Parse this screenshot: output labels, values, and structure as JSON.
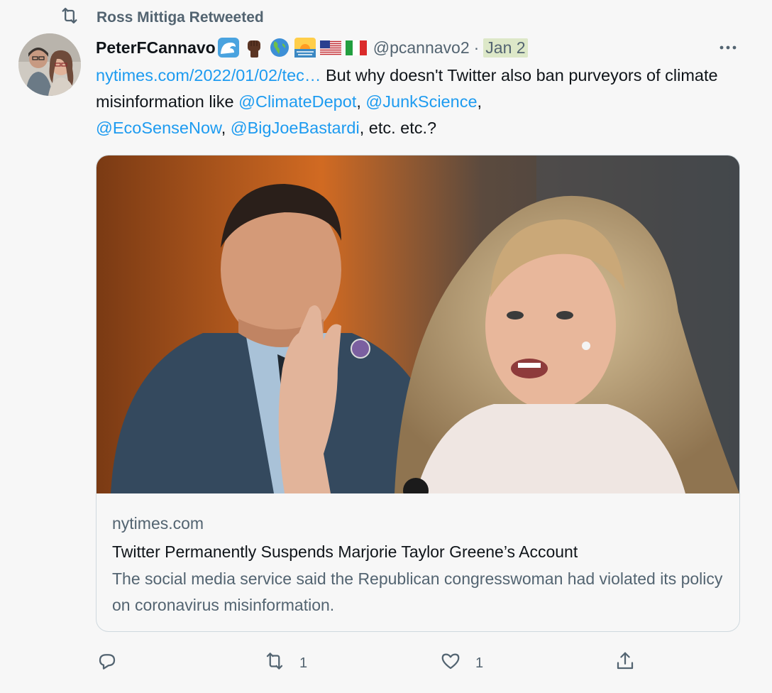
{
  "social_context": {
    "text": "Ross Mittiga Retweeted"
  },
  "author": {
    "display_name": "PeterFCannavo",
    "emojis": [
      "wave-emoji",
      "raised-fist-emoji",
      "globe-americas-emoji",
      "sunrise-emoji",
      "us-flag-emoji",
      "italy-flag-emoji"
    ],
    "handle": "@pcannavo2",
    "separator": "·",
    "timestamp": "Jan 2"
  },
  "tweet": {
    "link": "nytimes.com/2022/01/02/tec…",
    "text_1": " But why doesn't Twitter also ban purveyors of climate misinformation like ",
    "mention_1": "@ClimateDepot",
    "text_2": ", ",
    "mention_2": "@JunkScience",
    "text_3": ", ",
    "mention_3": "@EcoSenseNow",
    "text_4": ", ",
    "mention_4": "@BigJoeBastardi",
    "text_5": ", etc. etc.?"
  },
  "card": {
    "domain": "nytimes.com",
    "title": "Twitter Permanently Suspends Marjorie Taylor Greene’s Account",
    "description": "The social media service said the Republican congresswoman had violated its policy on coronavirus misinformation."
  },
  "actions": {
    "reply_icon": "reply-icon",
    "retweet_count": "1",
    "like_count": "1",
    "share_icon": "share-icon"
  },
  "colors": {
    "link": "#1d9bf0",
    "secondary_text": "#536471",
    "background": "#f7f7f7",
    "timestamp_highlight": "#dde8c8"
  }
}
